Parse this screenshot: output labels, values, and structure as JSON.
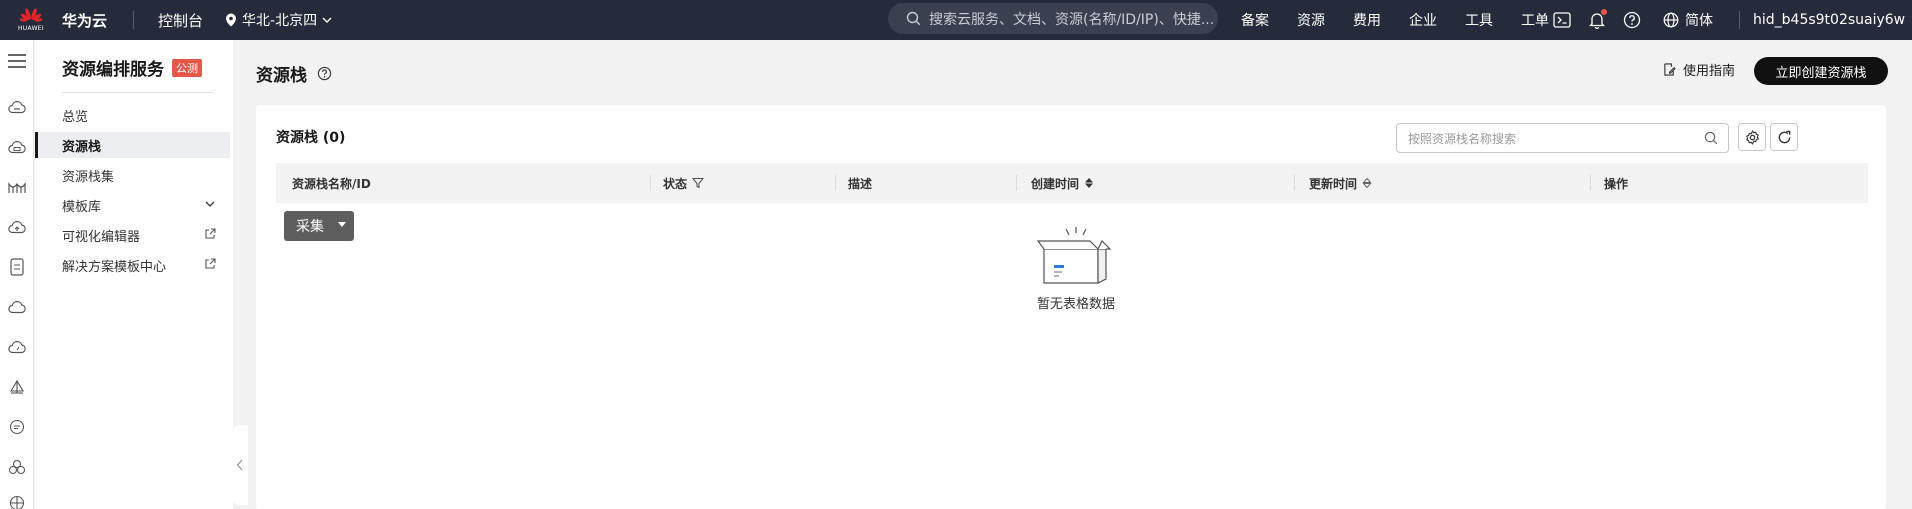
{
  "topbar": {
    "logo_text": "HUAWEI",
    "brand": "华为云",
    "console": "控制台",
    "region": "华北-北京四",
    "search_placeholder": "搜索云服务、文档、资源(名称/ID/IP)、快捷...",
    "nav": [
      "备案",
      "资源",
      "费用",
      "企业",
      "工具",
      "工单"
    ],
    "language": "简体",
    "username": "hid_b45s9t02suaiy6w",
    "notification_dot_color": "#e5564b"
  },
  "rail": {
    "icons": [
      "menu-icon",
      "cloud-icon",
      "cloud-server-icon",
      "bridge-icon",
      "cloud-upload-icon",
      "storage-icon",
      "cloud-outline-icon",
      "cloud-gauge-icon",
      "sail-icon",
      "chat-icon",
      "cluster-icon",
      "globe-icon"
    ]
  },
  "sidebar": {
    "title": "资源编排服务",
    "badge": "公测",
    "items": [
      {
        "label": "总览",
        "active": false
      },
      {
        "label": "资源栈",
        "active": true
      },
      {
        "label": "资源栈集",
        "active": false
      },
      {
        "label": "模板库",
        "active": false,
        "trail": "chevron-down-icon"
      },
      {
        "label": "可视化编辑器",
        "active": false,
        "trail": "external-link-icon"
      },
      {
        "label": "解决方案模板中心",
        "active": false,
        "trail": "external-link-icon"
      }
    ]
  },
  "main": {
    "page_title": "资源栈",
    "guide_label": "使用指南",
    "create_label": "立即创建资源栈",
    "card_title": "资源栈 (0)",
    "search_placeholder": "按照资源栈名称搜索",
    "columns": [
      "资源栈名称/ID",
      "状态",
      "描述",
      "创建时间",
      "更新时间",
      "操作"
    ],
    "collect_label": "采集",
    "empty_text": "暂无表格数据"
  }
}
